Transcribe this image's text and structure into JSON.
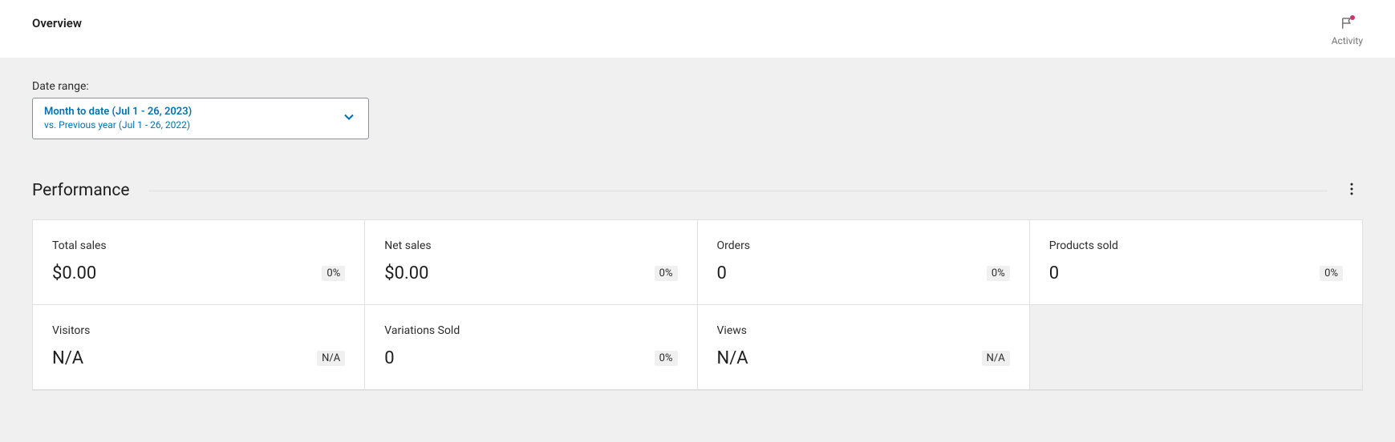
{
  "header": {
    "title": "Overview",
    "activity_label": "Activity"
  },
  "date_range": {
    "label": "Date range:",
    "primary": "Month to date (Jul 1 - 26, 2023)",
    "secondary": "vs. Previous year (Jul 1 - 26, 2022)"
  },
  "performance": {
    "title": "Performance",
    "metrics": [
      {
        "label": "Total sales",
        "value": "$0.00",
        "delta": "0%"
      },
      {
        "label": "Net sales",
        "value": "$0.00",
        "delta": "0%"
      },
      {
        "label": "Orders",
        "value": "0",
        "delta": "0%"
      },
      {
        "label": "Products sold",
        "value": "0",
        "delta": "0%"
      },
      {
        "label": "Visitors",
        "value": "N/A",
        "delta": "N/A"
      },
      {
        "label": "Variations Sold",
        "value": "0",
        "delta": "0%"
      },
      {
        "label": "Views",
        "value": "N/A",
        "delta": "N/A"
      }
    ]
  }
}
